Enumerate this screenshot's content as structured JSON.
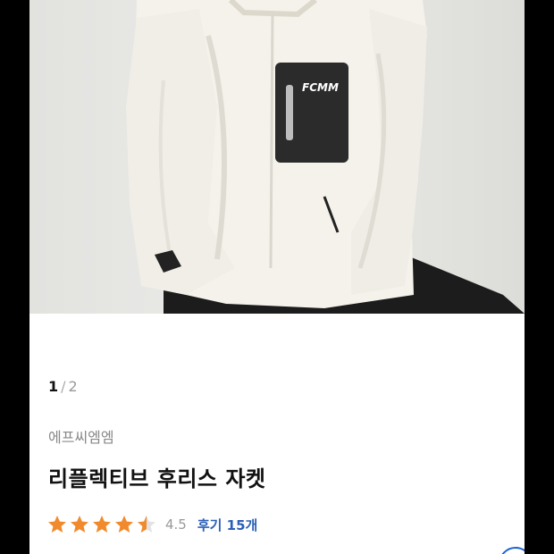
{
  "product": {
    "image_pager": {
      "current": "1",
      "separator": "/",
      "total": "2"
    },
    "photo_logo": "FCMM",
    "brand": "에프씨엠엠",
    "title": "리플렉티브 후리스 자켓",
    "rating": {
      "value": "4.5",
      "stars": 4.5,
      "max": 5,
      "reviews_label": "후기 15개"
    }
  },
  "colors": {
    "star": "#f18a2c",
    "review_link": "#2c5fb7",
    "fleece": "#f3f1ea",
    "pocket": "#2b2b2b"
  },
  "icons": {
    "star": "star-icon",
    "fab": "scroll-top-button"
  }
}
